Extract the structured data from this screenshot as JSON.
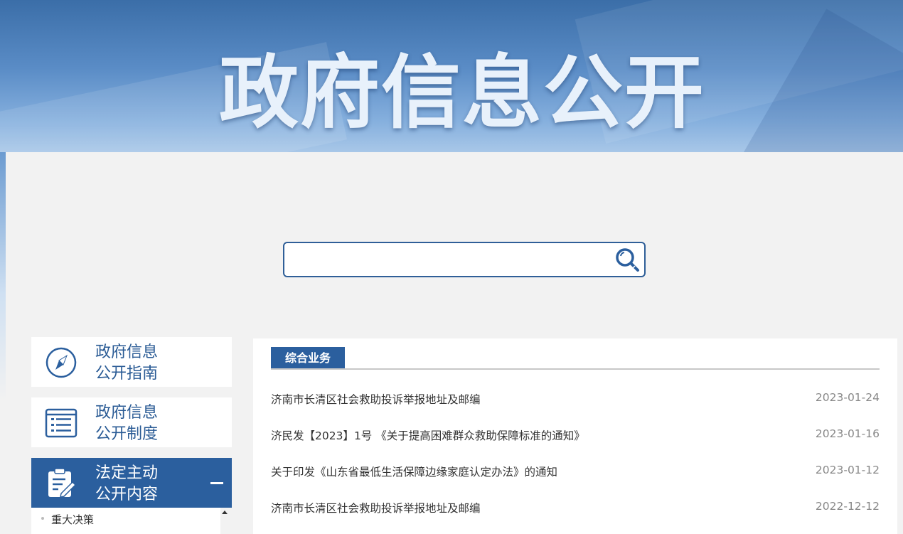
{
  "banner": {
    "title": "政府信息公开"
  },
  "search": {
    "placeholder": "",
    "value": ""
  },
  "sidebar": {
    "items": [
      {
        "line1": "政府信息",
        "line2": "公开指南"
      },
      {
        "line1": "政府信息",
        "line2": "公开制度"
      },
      {
        "line1": "法定主动",
        "line2": "公开内容"
      }
    ],
    "sub_items": [
      {
        "label": "重大决策"
      }
    ]
  },
  "panel": {
    "tab_label": "综合业务",
    "news": [
      {
        "title": "济南市长清区社会救助投诉举报地址及邮编",
        "date": "2023-01-24"
      },
      {
        "title": "济民发【2023】1号 《关于提高困难群众救助保障标准的通知》",
        "date": "2023-01-16"
      },
      {
        "title": "关于印发《山东省最低生活保障边缘家庭认定办法》的通知",
        "date": "2023-01-12"
      },
      {
        "title": "济南市长清区社会救助投诉举报地址及邮编",
        "date": "2022-12-12"
      }
    ]
  },
  "colors": {
    "primary": "#2b5f9e",
    "text": "#333333",
    "date": "#888888"
  }
}
